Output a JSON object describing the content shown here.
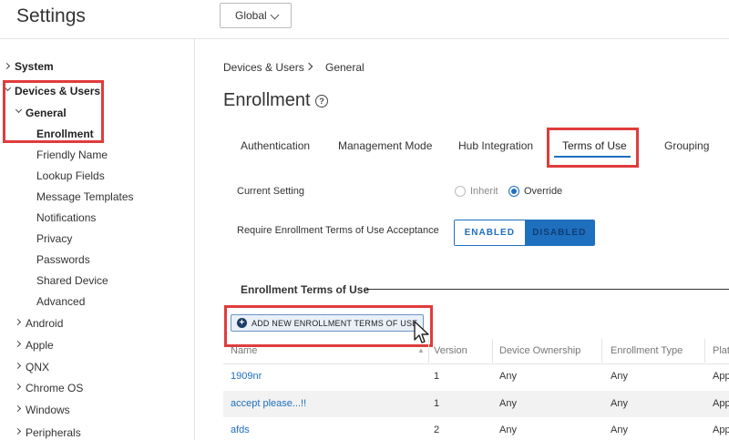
{
  "app": {
    "title": "Settings",
    "scope": "Global"
  },
  "sidebar": {
    "system": "System",
    "devices_users": "Devices & Users",
    "general": "General",
    "general_items": [
      "Enrollment",
      "Friendly Name",
      "Lookup Fields",
      "Message Templates",
      "Notifications",
      "Privacy",
      "Passwords",
      "Shared Device",
      "Advanced"
    ],
    "platforms": [
      "Android",
      "Apple",
      "QNX",
      "Chrome OS",
      "Windows",
      "Peripherals"
    ]
  },
  "breadcrumb": {
    "parent": "Devices & Users",
    "current": "General"
  },
  "page": {
    "title": "Enrollment",
    "help_icon": "?"
  },
  "tabs": [
    "Authentication",
    "Management Mode",
    "Hub Integration",
    "Terms of Use",
    "Grouping"
  ],
  "active_tab": "Terms of Use",
  "settings": {
    "current_setting_label": "Current Setting",
    "inherit_label": "Inherit",
    "override_label": "Override",
    "selected": "Override",
    "require_label": "Require Enrollment Terms of Use Acceptance",
    "enabled_label": "ENABLED",
    "disabled_label": "DISABLED",
    "toggle_value": "DISABLED"
  },
  "terms": {
    "section_title": "Enrollment Terms of Use",
    "add_button": "ADD NEW ENROLLMENT TERMS OF USE",
    "columns": [
      "Name",
      "Version",
      "Device Ownership",
      "Enrollment Type",
      "Plat"
    ],
    "rows": [
      {
        "name": "1909nr",
        "version": "1",
        "ownership": "Any",
        "type": "Any",
        "platform": "App"
      },
      {
        "name": "accept please...!!",
        "version": "1",
        "ownership": "Any",
        "type": "Any",
        "platform": "App"
      },
      {
        "name": "afds",
        "version": "2",
        "ownership": "Any",
        "type": "Any",
        "platform": "App"
      }
    ]
  },
  "colors": {
    "accent": "#1f6fbf",
    "highlight": "#e03c3c"
  }
}
